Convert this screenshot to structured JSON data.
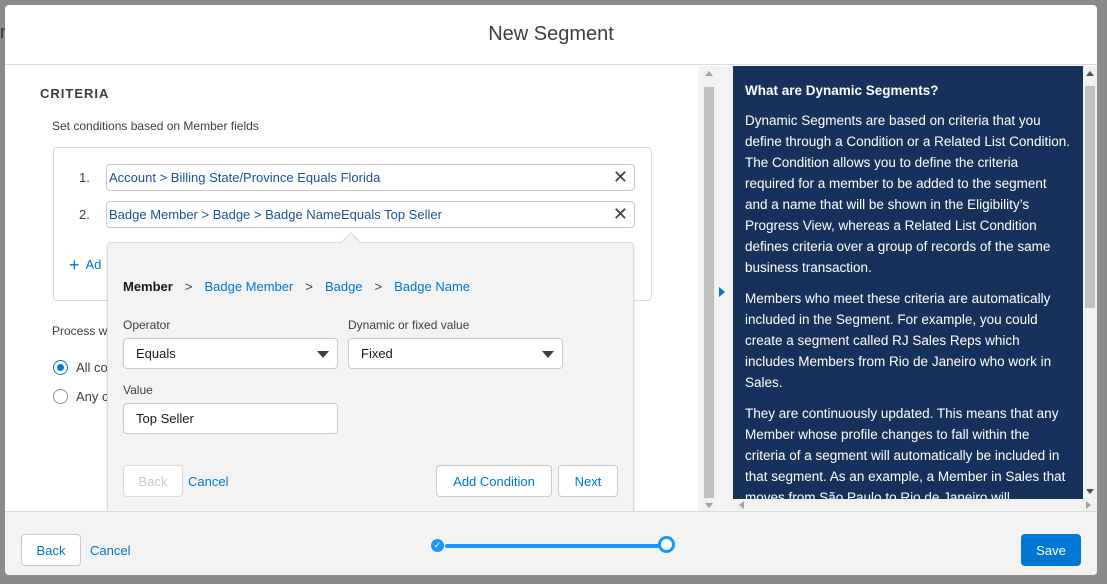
{
  "background": {
    "partial_text": "n"
  },
  "modal": {
    "title": "New Segment"
  },
  "criteria": {
    "section_title": "CRITERIA",
    "subtitle": "Set conditions based on Member fields",
    "conditions": [
      {
        "num": "1.",
        "text": "Account > Billing State/Province Equals Florida"
      },
      {
        "num": "2.",
        "text": "Badge Member > Badge > Badge NameEquals Top Seller"
      }
    ],
    "add_label": "Ad",
    "process_label": "Process wh",
    "radio_options": [
      {
        "label": "All co",
        "selected": true
      },
      {
        "label": "Any c",
        "selected": false
      }
    ]
  },
  "popover": {
    "breadcrumb": {
      "root": "Member",
      "separator": ">",
      "items": [
        "Badge Member",
        "Badge",
        "Badge Name"
      ]
    },
    "operator_label": "Operator",
    "operator_value": "Equals",
    "value_type_label": "Dynamic or fixed value",
    "value_type_value": "Fixed",
    "value_label": "Value",
    "value_input": "Top Seller",
    "back_button": "Back",
    "cancel_link": "Cancel",
    "add_condition_button": "Add Condition",
    "next_button": "Next"
  },
  "help": {
    "title": "What are Dynamic Segments?",
    "paragraphs": [
      "Dynamic Segments are based on criteria that you define through a Condition or a Related List Condition. The Condition allows you to define the criteria required for a member to be added to the segment and a name that will be shown in the Eligibility’s Progress View, whereas a Related List Condition defines criteria over a group of records of the same business transaction.",
      "Members who meet these criteria are automatically included in the Segment. For example, you could create a segment called RJ Sales Reps which includes Members from Rio de Janeiro who work in Sales.",
      "They are continuously updated. This means that any Member whose profile changes to fall within the criteria of a segment will automatically be included in that segment. As an example, a Member in Sales that moves from São Paulo to Rio de Janeiro will"
    ]
  },
  "footer": {
    "back_button": "Back",
    "cancel_link": "Cancel",
    "save_button": "Save",
    "progress": {
      "steps": 2,
      "current_step": 2
    }
  },
  "colors": {
    "brand": "#0176d3",
    "help_panel": "#16325c",
    "progress": "#1b96ff"
  }
}
